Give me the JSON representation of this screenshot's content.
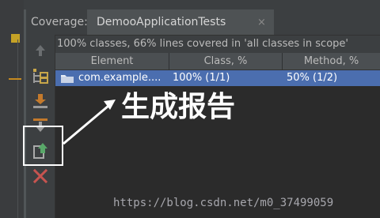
{
  "header": {
    "title": "Coverage:",
    "tab_label": "DemooApplicationTests",
    "tab_close": "×"
  },
  "summary_text": "100% classes, 66% lines covered in 'all classes in scope'",
  "table": {
    "columns": [
      "Element",
      "Class, %",
      "Method, %"
    ],
    "rows": [
      {
        "element": "com.example....",
        "class_pct": "100% (1/1)",
        "method_pct": "50% (1/2)"
      }
    ]
  },
  "toolbar": {
    "icons": [
      "up-arrow-icon",
      "tree-structure-icon",
      "import-icon",
      "export-icon",
      "generate-report-icon",
      "close-icon"
    ]
  },
  "annotation": {
    "text": "生成报告"
  },
  "watermark": "https://blog.csdn.net/m0_37499059",
  "colors": {
    "background": "#3c3f41",
    "selected_row": "#4b6eaf",
    "table_bg": "#2b2b2b",
    "export_orange": "#c47a2c",
    "report_green": "#59a869",
    "close_red": "#c75450"
  }
}
